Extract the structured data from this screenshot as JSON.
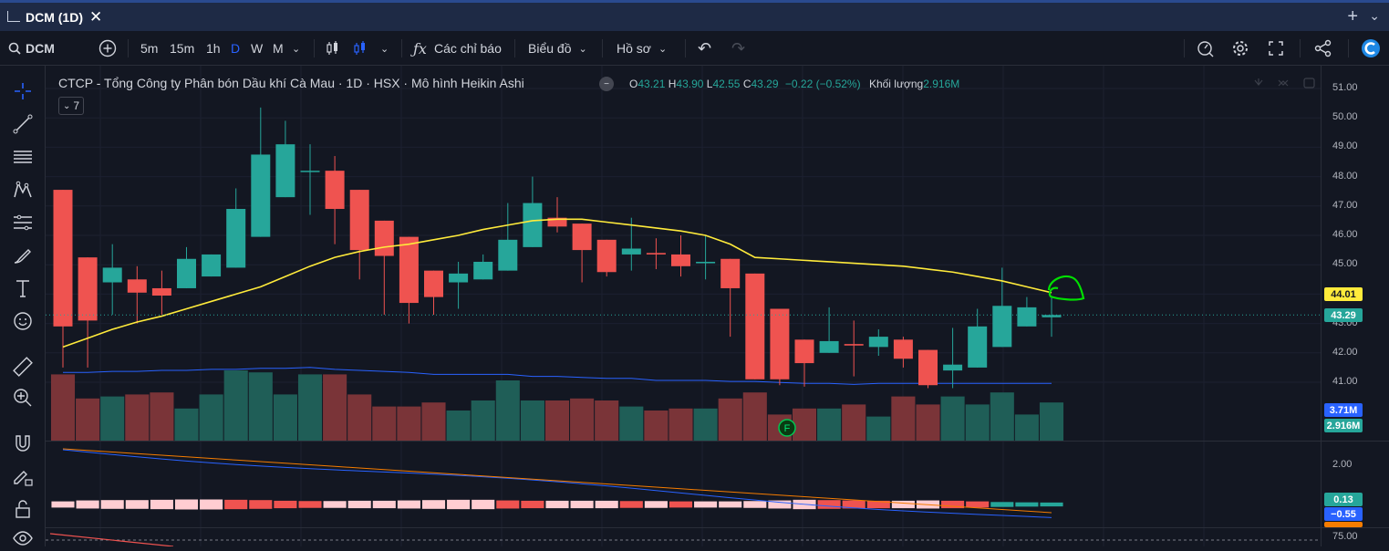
{
  "window": {
    "title": "DCM (1D)"
  },
  "toolbar": {
    "symbol": "DCM",
    "intervals": [
      "5m",
      "15m",
      "1h",
      "D",
      "W",
      "M"
    ],
    "selected_interval": "D",
    "indicators_label": "Các chỉ báo",
    "chart_label": "Biểu đồ",
    "profile_label": "Hồ sơ"
  },
  "legend": {
    "title": "CTCP - Tổng Công ty Phân bón Dầu khí Cà Mau · 1D · HSX · Mô hình Heikin Ashi",
    "o_label": "O",
    "o": "43.21",
    "h_label": "H",
    "h": "43.90",
    "l_label": "L",
    "l": "42.55",
    "c_label": "C",
    "c": "43.29",
    "change": "−0.22 (−0.52%)",
    "volume_label": "Khối lượng",
    "volume": "2.916M",
    "collapse_count": "7"
  },
  "price_axis": {
    "ticks": [
      "51.00",
      "50.00",
      "49.00",
      "48.00",
      "47.00",
      "46.00",
      "45.00",
      "44.00",
      "43.00",
      "42.00",
      "41.00"
    ],
    "ma_tag": "44.01",
    "last_tag": "43.29",
    "vol_ma_tag": "3.71M",
    "vol_tag": "2.916M"
  },
  "indicator_axis": {
    "tick_top": "2.00",
    "tag_a": "0.13",
    "tag_b": "−0.55",
    "tick_bottom": "75.00"
  },
  "colors": {
    "up": "#26a69a",
    "down": "#ef5350",
    "ma": "#ffeb3b",
    "vol_ma": "#2962ff",
    "annotation": "#00e000"
  },
  "chart_data": {
    "type": "candlestick",
    "candles": [
      {
        "o": 47.55,
        "h": 47.55,
        "l": 41.5,
        "c": 42.9
      },
      {
        "o": 45.25,
        "h": 45.25,
        "l": 41.5,
        "c": 43.1
      },
      {
        "o": 44.4,
        "h": 45.7,
        "l": 43.3,
        "c": 44.9
      },
      {
        "o": 44.5,
        "h": 44.95,
        "l": 43.0,
        "c": 44.05
      },
      {
        "o": 44.2,
        "h": 44.8,
        "l": 43.3,
        "c": 43.95
      },
      {
        "o": 44.2,
        "h": 45.6,
        "l": 44.2,
        "c": 45.2
      },
      {
        "o": 44.6,
        "h": 45.35,
        "l": 44.6,
        "c": 45.35
      },
      {
        "o": 44.9,
        "h": 47.6,
        "l": 44.9,
        "c": 46.9
      },
      {
        "o": 45.95,
        "h": 50.35,
        "l": 45.95,
        "c": 48.75
      },
      {
        "o": 47.3,
        "h": 49.9,
        "l": 47.3,
        "c": 49.1
      },
      {
        "o": 48.2,
        "h": 49.1,
        "l": 46.7,
        "c": 48.2
      },
      {
        "o": 48.2,
        "h": 48.7,
        "l": 45.7,
        "c": 46.9
      },
      {
        "o": 47.55,
        "h": 47.55,
        "l": 44.5,
        "c": 45.5
      },
      {
        "o": 46.5,
        "h": 46.5,
        "l": 43.3,
        "c": 45.3
      },
      {
        "o": 45.95,
        "h": 45.95,
        "l": 43.0,
        "c": 43.7
      },
      {
        "o": 44.8,
        "h": 44.8,
        "l": 43.3,
        "c": 43.9
      },
      {
        "o": 44.4,
        "h": 45.1,
        "l": 43.5,
        "c": 44.7
      },
      {
        "o": 44.5,
        "h": 45.35,
        "l": 44.5,
        "c": 45.1
      },
      {
        "o": 44.8,
        "h": 47.1,
        "l": 44.8,
        "c": 45.85
      },
      {
        "o": 45.6,
        "h": 48.0,
        "l": 45.6,
        "c": 47.1
      },
      {
        "o": 46.6,
        "h": 47.3,
        "l": 46.1,
        "c": 46.3
      },
      {
        "o": 46.4,
        "h": 46.4,
        "l": 44.4,
        "c": 45.5
      },
      {
        "o": 45.85,
        "h": 45.85,
        "l": 44.6,
        "c": 44.75
      },
      {
        "o": 45.35,
        "h": 46.6,
        "l": 44.8,
        "c": 45.55
      },
      {
        "o": 45.4,
        "h": 45.9,
        "l": 44.85,
        "c": 45.35
      },
      {
        "o": 45.35,
        "h": 46.0,
        "l": 44.6,
        "c": 44.95
      },
      {
        "o": 45.05,
        "h": 46.0,
        "l": 44.5,
        "c": 45.1
      },
      {
        "o": 45.2,
        "h": 45.2,
        "l": 42.55,
        "c": 44.2
      },
      {
        "o": 44.7,
        "h": 44.7,
        "l": 41.1,
        "c": 41.1
      },
      {
        "o": 43.5,
        "h": 43.5,
        "l": 40.9,
        "c": 41.1
      },
      {
        "o": 42.45,
        "h": 42.45,
        "l": 40.85,
        "c": 41.65
      },
      {
        "o": 42.0,
        "h": 43.55,
        "l": 42.0,
        "c": 42.4
      },
      {
        "o": 42.3,
        "h": 43.1,
        "l": 41.2,
        "c": 42.25
      },
      {
        "o": 42.2,
        "h": 42.8,
        "l": 41.9,
        "c": 42.55
      },
      {
        "o": 42.45,
        "h": 42.55,
        "l": 41.5,
        "c": 41.8
      },
      {
        "o": 42.1,
        "h": 42.1,
        "l": 40.8,
        "c": 40.9
      },
      {
        "o": 41.4,
        "h": 42.85,
        "l": 40.8,
        "c": 41.6
      },
      {
        "o": 41.5,
        "h": 43.5,
        "l": 41.5,
        "c": 42.9
      },
      {
        "o": 42.2,
        "h": 44.9,
        "l": 42.2,
        "c": 43.6
      },
      {
        "o": 42.9,
        "h": 43.9,
        "l": 42.9,
        "c": 43.55
      },
      {
        "o": 43.21,
        "h": 43.9,
        "l": 42.55,
        "c": 43.29
      }
    ],
    "ma": [
      42.2,
      42.5,
      42.8,
      43.05,
      43.25,
      43.5,
      43.75,
      44.0,
      44.25,
      44.6,
      44.95,
      45.25,
      45.45,
      45.6,
      45.7,
      45.85,
      46.0,
      46.2,
      46.35,
      46.5,
      46.55,
      46.55,
      46.45,
      46.35,
      46.25,
      46.15,
      46.0,
      45.7,
      45.25,
      45.2,
      45.15,
      45.1,
      45.05,
      45.0,
      44.95,
      44.85,
      44.75,
      44.6,
      44.45,
      44.25,
      44.05
    ],
    "volumes": [
      3.3,
      2.1,
      2.2,
      2.3,
      2.4,
      1.6,
      2.3,
      3.5,
      3.4,
      2.3,
      3.3,
      3.3,
      2.3,
      1.7,
      1.7,
      1.9,
      1.5,
      2.0,
      3.0,
      2.0,
      2.0,
      2.1,
      2.0,
      1.7,
      1.5,
      1.6,
      1.6,
      2.1,
      2.4,
      1.3,
      1.6,
      1.6,
      1.8,
      1.2,
      2.2,
      1.8,
      2.2,
      1.8,
      2.4,
      1.3,
      1.9
    ],
    "vol_ma": [
      3.4,
      3.4,
      3.45,
      3.45,
      3.5,
      3.5,
      3.55,
      3.55,
      3.6,
      3.6,
      3.65,
      3.55,
      3.5,
      3.45,
      3.4,
      3.3,
      3.3,
      3.3,
      3.3,
      3.2,
      3.2,
      3.15,
      3.1,
      3.1,
      3.0,
      3.0,
      3.0,
      2.95,
      2.95,
      2.9,
      2.85,
      2.85,
      2.8,
      2.85,
      2.85,
      2.85,
      2.85,
      2.85,
      2.85,
      2.85,
      2.85
    ],
    "osc": [
      0.2,
      0.35,
      0.4,
      0.4,
      0.45,
      0.5,
      0.5,
      0.45,
      0.4,
      0.3,
      0.25,
      0.25,
      0.3,
      0.3,
      0.35,
      0.4,
      0.45,
      0.45,
      0.35,
      0.3,
      0.3,
      0.3,
      0.3,
      0.25,
      0.25,
      0.2,
      0.2,
      0.2,
      0.25,
      0.35,
      0.45,
      0.4,
      0.35,
      0.3,
      0.3,
      0.35,
      0.3,
      0.2,
      0.1,
      0.05,
      0.02
    ]
  }
}
